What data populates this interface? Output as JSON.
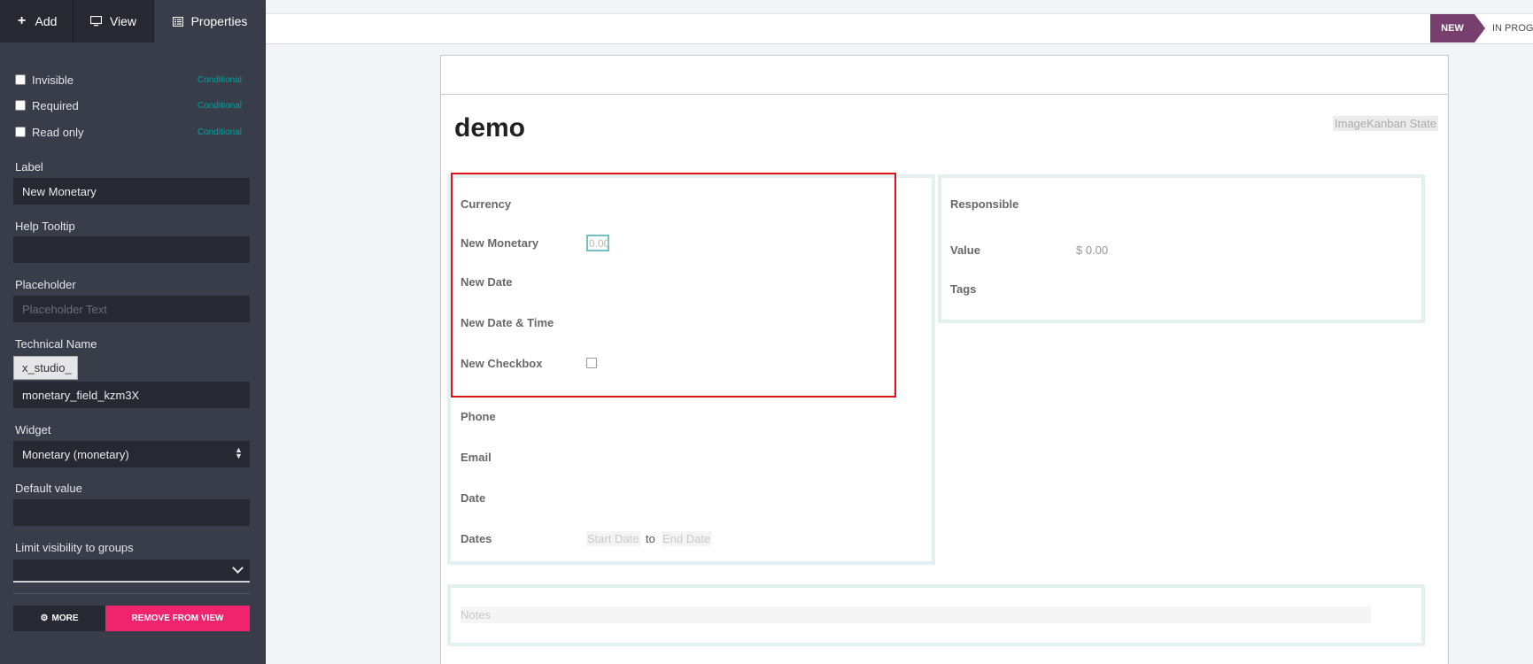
{
  "sidebar": {
    "tabs": [
      {
        "label": "Add",
        "icon": "plus-icon"
      },
      {
        "label": "View",
        "icon": "monitor-icon"
      },
      {
        "label": "Properties",
        "icon": "list-icon"
      }
    ],
    "checkboxes": [
      {
        "label": "Invisible",
        "link": "Conditional"
      },
      {
        "label": "Required",
        "link": "Conditional"
      },
      {
        "label": "Read only",
        "link": "Conditional"
      }
    ],
    "label_caption": "Label",
    "label_value": "New Monetary",
    "help_caption": "Help Tooltip",
    "help_value": "",
    "placeholder_caption": "Placeholder",
    "placeholder_hint": "Placeholder Text",
    "technical_caption": "Technical Name",
    "technical_prefix": "x_studio_",
    "technical_value": "monetary_field_kzm3X",
    "widget_caption": "Widget",
    "widget_value": "Monetary (monetary)",
    "default_caption": "Default value",
    "default_value": "",
    "groups_caption": "Limit visibility to groups",
    "more_label": "MORE",
    "remove_label": "REMOVE FROM VIEW"
  },
  "statusbar": {
    "stages": [
      "NEW",
      "IN PROGRESS"
    ],
    "active_stage": "NEW",
    "accent": "#763f6e"
  },
  "record": {
    "title": "demo",
    "title_tags": "ImageKanban State"
  },
  "left_group": {
    "fields": [
      {
        "label": "Currency",
        "value": ""
      },
      {
        "label": "New Monetary",
        "value": "0.00"
      },
      {
        "label": "New Date",
        "value": ""
      },
      {
        "label": "New Date & Time",
        "value": ""
      },
      {
        "label": "New Checkbox",
        "value": "unchecked"
      },
      {
        "label": "Phone",
        "value": ""
      },
      {
        "label": "Email",
        "value": ""
      },
      {
        "label": "Date",
        "value": ""
      },
      {
        "label": "Dates",
        "value": ""
      }
    ],
    "date_start_placeholder": "Start Date",
    "date_separator": "to",
    "date_end_placeholder": "End Date"
  },
  "right_group": {
    "fields": [
      {
        "label": "Responsible",
        "value": ""
      },
      {
        "label": "Value",
        "value": "$ 0.00"
      },
      {
        "label": "Tags",
        "value": ""
      }
    ]
  },
  "notes": {
    "placeholder": "Notes"
  },
  "colors": {
    "selection": "#e30f1b",
    "remove_button": "#f0246d",
    "conditional_link": "#00a09d",
    "sidebar_bg": "#393d49"
  }
}
